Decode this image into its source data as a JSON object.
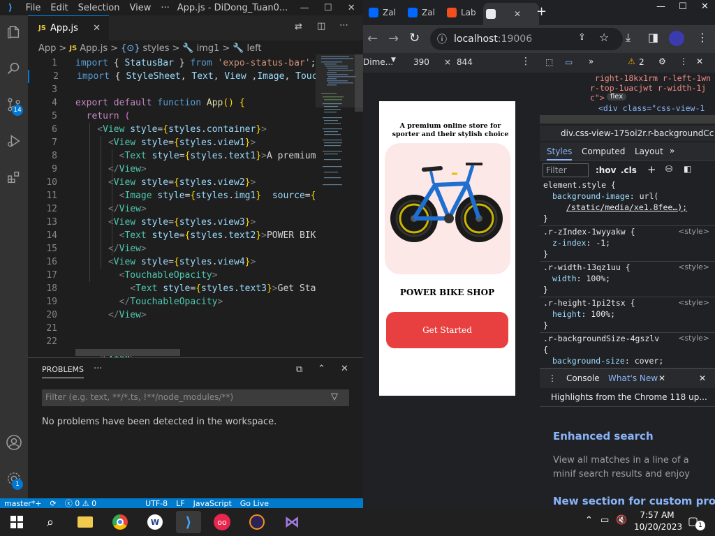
{
  "vscode": {
    "menu": [
      "File",
      "Edit",
      "Selection",
      "View",
      "···"
    ],
    "window_title": "App.js - DiDong_Tuan0...",
    "scm_badge": "14",
    "settings_badge": "1",
    "tab": {
      "icon": "JS",
      "label": "App.js"
    },
    "breadcrumb": [
      "App",
      ">",
      "JS",
      "App.js",
      ">",
      "styles",
      ">",
      "img1",
      ">",
      "left"
    ],
    "code_lines": [
      {
        "n": "1",
        "parts": [
          [
            "kw",
            "import"
          ],
          [
            "",
            " { "
          ],
          [
            "var",
            "StatusBar"
          ],
          [
            "",
            " } "
          ],
          [
            "kw",
            "from"
          ],
          [
            "",
            " "
          ],
          [
            "str",
            "'expo-status-bar'"
          ],
          [
            "",
            ";"
          ]
        ]
      },
      {
        "n": "2",
        "parts": [
          [
            "kw",
            "import"
          ],
          [
            "",
            " { "
          ],
          [
            "var",
            "StyleSheet"
          ],
          [
            "",
            ", "
          ],
          [
            "var",
            "Text"
          ],
          [
            "",
            ", "
          ],
          [
            "var",
            "View"
          ],
          [
            "",
            " ,"
          ],
          [
            "var",
            "Image"
          ],
          [
            "",
            ", "
          ],
          [
            "var",
            "Touch"
          ]
        ]
      },
      {
        "n": "3",
        "parts": []
      },
      {
        "n": "4",
        "parts": [
          [
            "kw2",
            "export"
          ],
          [
            "",
            " "
          ],
          [
            "kw2",
            "default"
          ],
          [
            "",
            " "
          ],
          [
            "kw",
            "function"
          ],
          [
            "",
            " "
          ],
          [
            "fn",
            "App"
          ],
          [
            "br",
            "()"
          ],
          [
            "",
            " "
          ],
          [
            "br",
            "{"
          ]
        ]
      },
      {
        "n": "5",
        "parts": [
          [
            "",
            ""
          ],
          [
            "kw2",
            "  return"
          ],
          [
            "",
            " "
          ],
          [
            "br2",
            "("
          ]
        ]
      },
      {
        "n": "6",
        "parts": [
          [
            "pun",
            "    <"
          ],
          [
            "tag",
            "View"
          ],
          [
            "",
            " "
          ],
          [
            "var",
            "style"
          ],
          [
            "",
            "="
          ],
          [
            "br",
            "{"
          ],
          [
            "var",
            "styles"
          ],
          [
            "",
            "."
          ],
          [
            "var",
            "container"
          ],
          [
            "br",
            "}"
          ],
          [
            "pun",
            ">"
          ]
        ]
      },
      {
        "n": "7",
        "parts": [
          [
            "pun",
            "      <"
          ],
          [
            "tag",
            "View"
          ],
          [
            "",
            " "
          ],
          [
            "var",
            "style"
          ],
          [
            "",
            "="
          ],
          [
            "br",
            "{"
          ],
          [
            "var",
            "styles"
          ],
          [
            "",
            "."
          ],
          [
            "var",
            "view1"
          ],
          [
            "br",
            "}"
          ],
          [
            "pun",
            ">"
          ]
        ]
      },
      {
        "n": "8",
        "parts": [
          [
            "pun",
            "        <"
          ],
          [
            "tag",
            "Text"
          ],
          [
            "",
            " "
          ],
          [
            "var",
            "style"
          ],
          [
            "",
            "="
          ],
          [
            "br",
            "{"
          ],
          [
            "var",
            "styles"
          ],
          [
            "",
            "."
          ],
          [
            "var",
            "text1"
          ],
          [
            "br",
            "}"
          ],
          [
            "pun",
            ">"
          ],
          [
            "",
            "A premium"
          ]
        ]
      },
      {
        "n": "9",
        "parts": [
          [
            "pun",
            "      </"
          ],
          [
            "tag",
            "View"
          ],
          [
            "pun",
            ">"
          ]
        ]
      },
      {
        "n": "10",
        "parts": [
          [
            "pun",
            "      <"
          ],
          [
            "tag",
            "View"
          ],
          [
            "",
            " "
          ],
          [
            "var",
            "style"
          ],
          [
            "",
            "="
          ],
          [
            "br",
            "{"
          ],
          [
            "var",
            "styles"
          ],
          [
            "",
            "."
          ],
          [
            "var",
            "view2"
          ],
          [
            "br",
            "}"
          ],
          [
            "pun",
            ">"
          ]
        ]
      },
      {
        "n": "11",
        "parts": [
          [
            "pun",
            "        <"
          ],
          [
            "tag",
            "Image"
          ],
          [
            "",
            " "
          ],
          [
            "var",
            "style"
          ],
          [
            "",
            "="
          ],
          [
            "br",
            "{"
          ],
          [
            "var",
            "styles"
          ],
          [
            "",
            "."
          ],
          [
            "var",
            "img1"
          ],
          [
            "br",
            "}"
          ],
          [
            "",
            "  "
          ],
          [
            "var",
            "source"
          ],
          [
            "",
            "="
          ],
          [
            "br",
            "{"
          ],
          [
            "var",
            "r"
          ]
        ]
      },
      {
        "n": "12",
        "parts": [
          [
            "pun",
            "      </"
          ],
          [
            "tag",
            "View"
          ],
          [
            "pun",
            ">"
          ]
        ]
      },
      {
        "n": "13",
        "parts": [
          [
            "pun",
            "      <"
          ],
          [
            "tag",
            "View"
          ],
          [
            "",
            " "
          ],
          [
            "var",
            "style"
          ],
          [
            "",
            "="
          ],
          [
            "br",
            "{"
          ],
          [
            "var",
            "styles"
          ],
          [
            "",
            "."
          ],
          [
            "var",
            "view3"
          ],
          [
            "br",
            "}"
          ],
          [
            "pun",
            ">"
          ]
        ]
      },
      {
        "n": "14",
        "parts": [
          [
            "pun",
            "        <"
          ],
          [
            "tag",
            "Text"
          ],
          [
            "",
            " "
          ],
          [
            "var",
            "style"
          ],
          [
            "",
            "="
          ],
          [
            "br",
            "{"
          ],
          [
            "var",
            "styles"
          ],
          [
            "",
            "."
          ],
          [
            "var",
            "text2"
          ],
          [
            "br",
            "}"
          ],
          [
            "pun",
            ">"
          ],
          [
            "",
            "POWER BIKE"
          ]
        ]
      },
      {
        "n": "15",
        "parts": [
          [
            "pun",
            "      </"
          ],
          [
            "tag",
            "View"
          ],
          [
            "pun",
            ">"
          ]
        ]
      },
      {
        "n": "16",
        "parts": [
          [
            "pun",
            "      <"
          ],
          [
            "tag",
            "View"
          ],
          [
            "",
            " "
          ],
          [
            "var",
            "style"
          ],
          [
            "",
            "="
          ],
          [
            "br",
            "{"
          ],
          [
            "var",
            "styles"
          ],
          [
            "",
            "."
          ],
          [
            "var",
            "view4"
          ],
          [
            "br",
            "}"
          ],
          [
            "pun",
            ">"
          ]
        ]
      },
      {
        "n": "17",
        "parts": [
          [
            "pun",
            "        <"
          ],
          [
            "tag",
            "TouchableOpacity"
          ],
          [
            "pun",
            ">"
          ]
        ]
      },
      {
        "n": "18",
        "parts": [
          [
            "pun",
            "          <"
          ],
          [
            "tag",
            "Text"
          ],
          [
            "",
            " "
          ],
          [
            "var",
            "style"
          ],
          [
            "",
            "="
          ],
          [
            "br",
            "{"
          ],
          [
            "var",
            "styles"
          ],
          [
            "",
            "."
          ],
          [
            "var",
            "text3"
          ],
          [
            "br",
            "}"
          ],
          [
            "pun",
            ">"
          ],
          [
            "",
            "Get Star"
          ]
        ]
      },
      {
        "n": "19",
        "parts": [
          [
            "pun",
            "        </"
          ],
          [
            "tag",
            "TouchableOpacity"
          ],
          [
            "pun",
            ">"
          ]
        ]
      },
      {
        "n": "20",
        "parts": [
          [
            "pun",
            "      </"
          ],
          [
            "tag",
            "View"
          ],
          [
            "pun",
            ">"
          ]
        ]
      },
      {
        "n": "21",
        "parts": []
      },
      {
        "n": "22",
        "parts": []
      },
      {
        "n": "",
        "parts": [
          [
            "pun",
            "    </"
          ],
          [
            "tag",
            "View"
          ],
          [
            "pun",
            ">"
          ]
        ]
      }
    ],
    "panel": {
      "tab": "PROBLEMS",
      "more": "···",
      "filter_placeholder": "Filter (e.g. text, **/*.ts, !**/node_modules/**)",
      "message": "No problems have been detected in the workspace."
    },
    "status": [
      "master*+",
      "ⓧ 0 ⚠ 0",
      "UTF-8",
      "LF",
      "JavaScript",
      "Go Live"
    ]
  },
  "chrome": {
    "tabs": [
      {
        "label": "Zal",
        "icon": "Zalo",
        "color": "#0068ff"
      },
      {
        "label": "Zal",
        "icon": "Zalo",
        "color": "#0068ff"
      },
      {
        "label": "Lab",
        "icon": "figma",
        "color": "#f24e1e"
      },
      {
        "label": "",
        "icon": "page",
        "color": "#e8eaed"
      }
    ],
    "url_host": "localhost",
    "url_port": ":19006",
    "device": {
      "name": "Dime...",
      "width": "390",
      "x": "×",
      "height": "844"
    },
    "app": {
      "headline": "A premium online store for sporter and their stylish choice",
      "shop_name": "POWER BIKE SHOP",
      "button": "Get Started",
      "button_color": "#e84040",
      "image_bg": "#fde8e8"
    },
    "devtools": {
      "warning_count": "2",
      "dom_lines": [
        " right-18kx1rm r-left-1wn",
        "r-top-1uacjwt r-width-1j",
        "c\">"
      ],
      "flex_badge": "flex",
      "dom_selected": "<div class=\"css-view-1",
      "breadcrumb": "div.css-view-175oi2r.r-backgroundCc",
      "tabs": [
        "Styles",
        "Computed",
        "Layout",
        "»"
      ],
      "filter": "Filter",
      "hov": ":hov",
      "cls": ".cls",
      "rules": [
        {
          "sel": "element.style {",
          "src": "",
          "props": [
            [
              "background-image",
              "url("
            ],
            [
              "",
              "/static/media/xe1.8fee…);"
            ]
          ],
          "close": "}"
        },
        {
          "sel": ".r-zIndex-1wyyakw {",
          "src": "<style>",
          "props": [
            [
              "z-index",
              "-1;"
            ]
          ],
          "close": "}"
        },
        {
          "sel": ".r-width-13qz1uu {",
          "src": "<style>",
          "props": [
            [
              "width",
              "100%;"
            ]
          ],
          "close": "}"
        },
        {
          "sel": ".r-height-1pi2tsx {",
          "src": "<style>",
          "props": [
            [
              "height",
              "100%;"
            ]
          ],
          "close": "}"
        },
        {
          "sel": ".r-backgroundSize-4gszlv",
          "src": "<style>",
          "props": [
            [
              "",
              "{"
            ],
            [
              "background-size",
              "cover;"
            ]
          ],
          "close": ""
        }
      ],
      "console_tab": "Console",
      "whats_new_tab": "What's New",
      "highlights": "Highlights from the Chrome 118 up...",
      "news": [
        {
          "title": "Enhanced search",
          "body": "View all matches in a line of a minif search results and enjoy boosted se"
        },
        {
          "title": "New section for custom prop",
          "body": ""
        }
      ]
    }
  },
  "taskbar": {
    "time": "7:57 AM",
    "date": "10/20/2023",
    "notif_count": "1"
  }
}
